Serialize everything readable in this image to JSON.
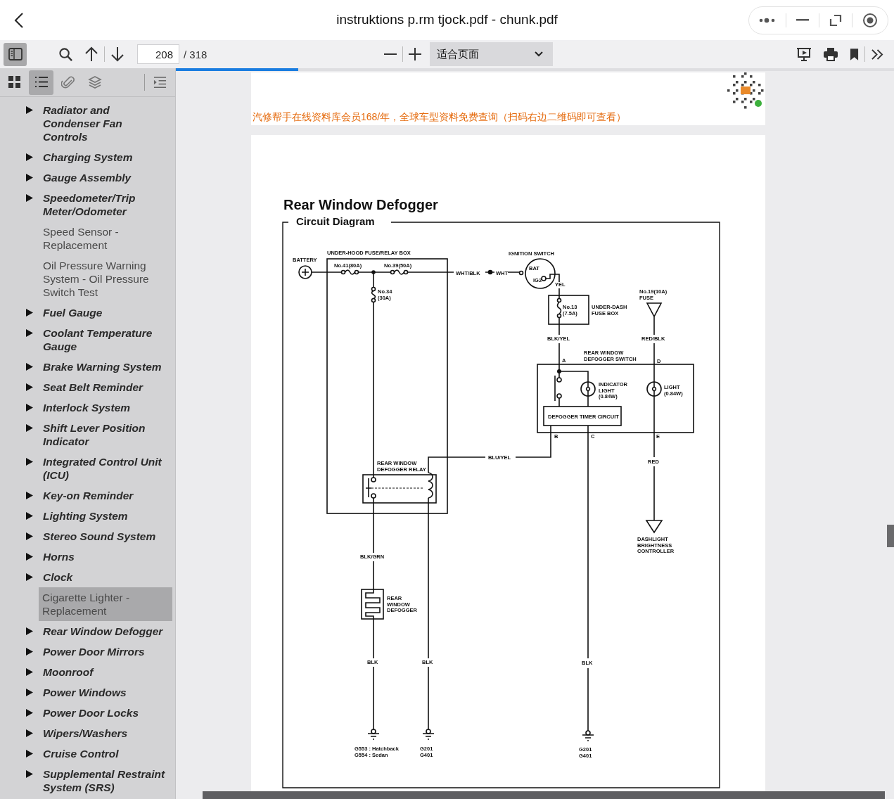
{
  "window": {
    "title": "instruktions p.rm tjock.pdf - chunk.pdf"
  },
  "toolbar": {
    "sidebar_toggle_on": true,
    "page_input": "208",
    "page_total": "/ 318",
    "zoom_select": "适合页面"
  },
  "progress": {
    "level": 0.17
  },
  "sidebar": {
    "tabs": [
      {
        "kind": "thumbnails",
        "selected": false
      },
      {
        "kind": "outline",
        "selected": true
      },
      {
        "kind": "attachments",
        "selected": false
      },
      {
        "kind": "layers",
        "selected": false
      }
    ],
    "items": [
      {
        "label": "Radiator and Condenser Fan Controls",
        "kind": "section",
        "selected": false
      },
      {
        "label": "Charging System",
        "kind": "section",
        "selected": false
      },
      {
        "label": "Gauge Assembly",
        "kind": "section",
        "selected": false
      },
      {
        "label": "Speedometer/Trip Meter/Odometer",
        "kind": "section",
        "selected": false
      },
      {
        "label": "Speed Sensor - Replacement",
        "kind": "page",
        "selected": false
      },
      {
        "label": "Oil Pressure Warning System - Oil Pressure Switch Test",
        "kind": "page",
        "selected": false
      },
      {
        "label": "Fuel Gauge",
        "kind": "section",
        "selected": false
      },
      {
        "label": "Coolant Temperature Gauge",
        "kind": "section",
        "selected": false
      },
      {
        "label": "Brake Warning System",
        "kind": "section",
        "selected": false
      },
      {
        "label": "Seat Belt Reminder",
        "kind": "section",
        "selected": false
      },
      {
        "label": "Interlock System",
        "kind": "section",
        "selected": false
      },
      {
        "label": "Shift Lever Position Indicator",
        "kind": "section",
        "selected": false
      },
      {
        "label": "Integrated Control Unit (ICU)",
        "kind": "section",
        "selected": false
      },
      {
        "label": "Key-on Reminder",
        "kind": "section",
        "selected": false
      },
      {
        "label": "Lighting System",
        "kind": "section",
        "selected": false
      },
      {
        "label": "Stereo Sound System",
        "kind": "section",
        "selected": false
      },
      {
        "label": "Horns",
        "kind": "section",
        "selected": false
      },
      {
        "label": "Clock",
        "kind": "section",
        "selected": false
      },
      {
        "label": "Cigarette Lighter - Replacement",
        "kind": "page",
        "selected": true
      },
      {
        "label": "Rear Window Defogger",
        "kind": "section",
        "selected": false
      },
      {
        "label": "Power Door Mirrors",
        "kind": "section",
        "selected": false
      },
      {
        "label": "Moonroof",
        "kind": "section",
        "selected": false
      },
      {
        "label": "Power Windows",
        "kind": "section",
        "selected": false
      },
      {
        "label": "Power Door Locks",
        "kind": "section",
        "selected": false
      },
      {
        "label": "Wipers/Washers",
        "kind": "section",
        "selected": false
      },
      {
        "label": "Cruise Control",
        "kind": "section",
        "selected": false
      },
      {
        "label": "Supplemental Restraint System (SRS)",
        "kind": "section",
        "selected": false
      }
    ]
  },
  "document": {
    "banner": "汽修帮手在线资料库会员168/年，全球车型资料免费查询（扫码右边二维码即可查看）",
    "diagram": {
      "title": "Rear Window Defogger",
      "subtitle": "Circuit Diagram",
      "labels": [
        "BATTERY",
        "UNDER-HOOD FUSE/RELAY BOX",
        "No.41(80A)",
        "No.39(50A)",
        "No.34\n(30A)",
        "WHT/BLK",
        "WHT",
        "IGNITION SWITCH",
        "BAT",
        "IG2",
        "YEL",
        "No.13\n(7.5A)",
        "UNDER-DASH\nFUSE BOX",
        "No.19(10A)\nFUSE",
        "BLK/YEL",
        "RED/BLK",
        "REAR WINDOW\nDEFOGGER SWITCH",
        "A",
        "D",
        "INDICATOR\nLIGHT\n(0.84W)",
        "LIGHT\n(0.84W)",
        "DEFOGGER TIMER CIRCUIT",
        "B",
        "C",
        "E",
        "BLU/YEL",
        "RED",
        "REAR WINDOW\nDEFOGGER RELAY",
        "DASHLIGHT\nBRIGHTNESS\nCONTROLLER",
        "BLK/GRN",
        "REAR\nWINDOW\nDEFOGGER",
        "BLK",
        "BLK",
        "BLK",
        "G553 : Hatchback\nG554 : Sedan",
        "G201\nG401",
        "G201\nG401"
      ]
    }
  }
}
